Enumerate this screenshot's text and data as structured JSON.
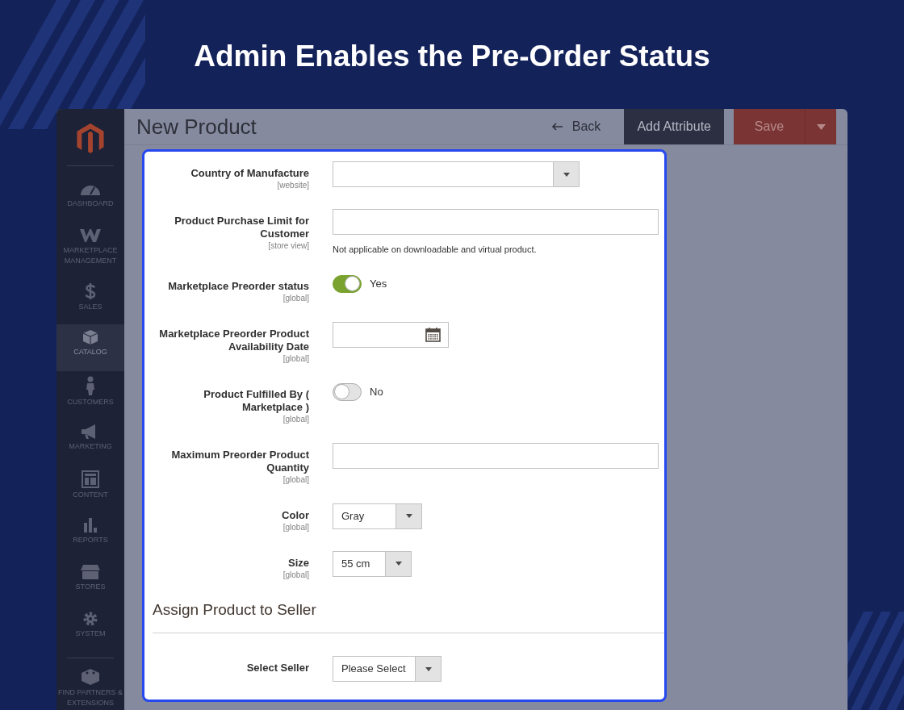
{
  "headline": "Admin Enables the Pre-Order Status",
  "sidebar": {
    "items": [
      {
        "label": "DASHBOARD",
        "selected": false
      },
      {
        "label": "MARKETPLACE MANAGEMENT",
        "selected": false
      },
      {
        "label": "SALES",
        "selected": false
      },
      {
        "label": "CATALOG",
        "selected": true
      },
      {
        "label": "CUSTOMERS",
        "selected": false
      },
      {
        "label": "MARKETING",
        "selected": false
      },
      {
        "label": "CONTENT",
        "selected": false
      },
      {
        "label": "REPORTS",
        "selected": false
      },
      {
        "label": "STORES",
        "selected": false
      },
      {
        "label": "SYSTEM",
        "selected": false
      },
      {
        "label": "FIND PARTNERS & EXTENSIONS",
        "selected": false
      }
    ]
  },
  "header": {
    "title": "New Product",
    "back": "Back",
    "add_attribute": "Add Attribute",
    "save": "Save"
  },
  "fields": [
    {
      "kind": "select",
      "label": "Country of Manufacture",
      "scope": "[website]"
    },
    {
      "kind": "text",
      "label": "Product Purchase Limit for Customer",
      "scope": "[store view]",
      "note": "Not applicable on downloadable and virtual product."
    },
    {
      "kind": "toggle",
      "label": "Marketplace Preorder status",
      "scope": "[global]",
      "on": true,
      "state_label": "Yes"
    },
    {
      "kind": "date",
      "label": "Marketplace Preorder Product Availability Date",
      "scope": "[global]"
    },
    {
      "kind": "toggle",
      "label": "Product Fulfilled By ( Marketplace )",
      "scope": "[global]",
      "on": false,
      "state_label": "No"
    },
    {
      "kind": "text",
      "label": "Maximum Preorder Product Quantity",
      "scope": "[global]"
    },
    {
      "kind": "select",
      "label": "Color",
      "scope": "[global]",
      "value": "Gray"
    },
    {
      "kind": "select",
      "label": "Size",
      "scope": "[global]",
      "value": "55 cm"
    }
  ],
  "section": {
    "title": "Assign Product to Seller",
    "fields": [
      {
        "kind": "select",
        "label": "Select Seller",
        "value": "Please Select"
      }
    ]
  }
}
